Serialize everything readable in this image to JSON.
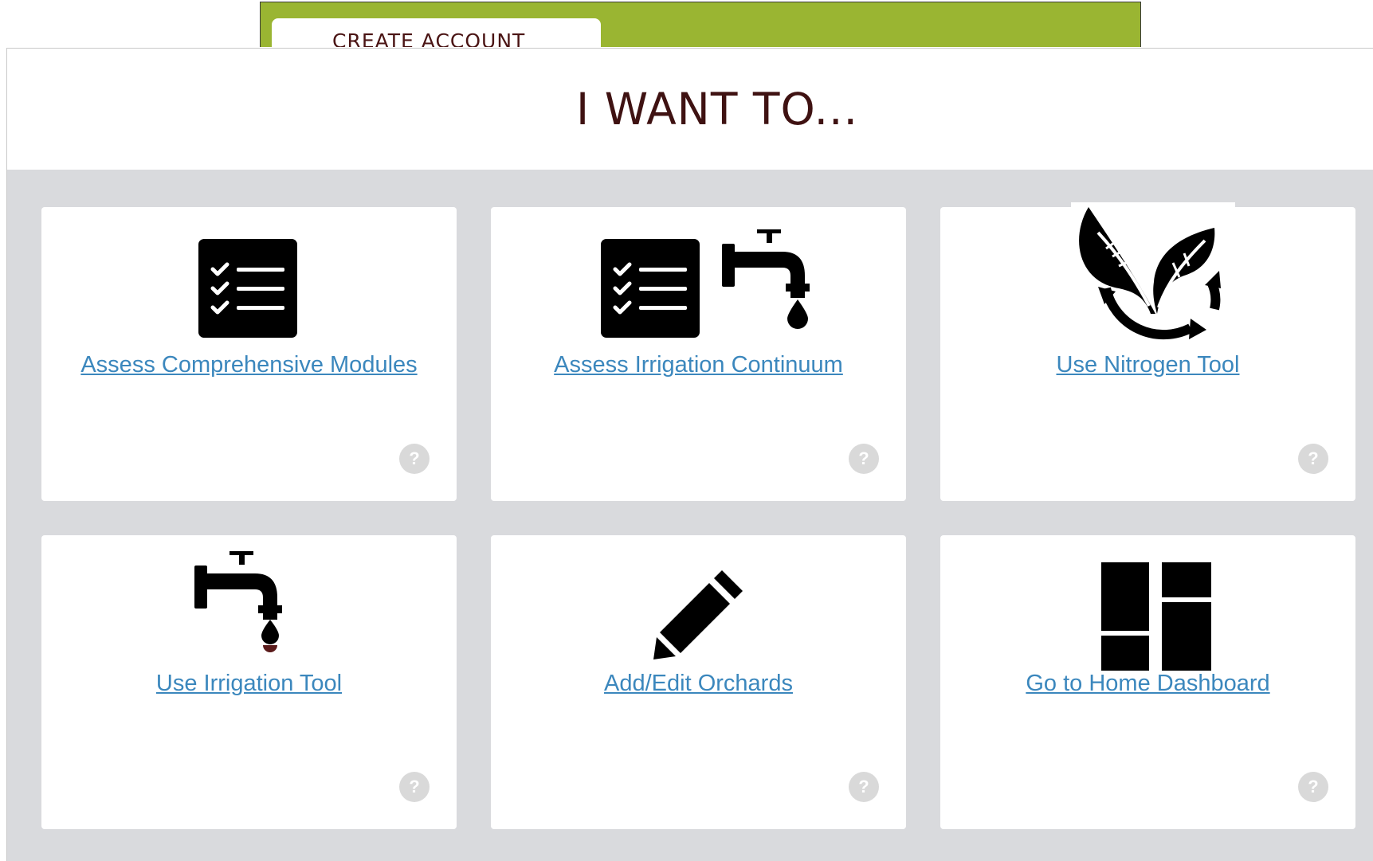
{
  "top_bar": {
    "tab_label": "CREATE ACCOUNT",
    "accent_color": "#9ab532"
  },
  "modal": {
    "title": "I WANT TO..."
  },
  "cards": [
    {
      "label": "Assess Comprehensive Modules",
      "icon": "checklist-icon",
      "help": "?"
    },
    {
      "label": "Assess Irrigation Continuum",
      "icon": "checklist-faucet-icon",
      "help": "?"
    },
    {
      "label": "Use Nitrogen Tool",
      "icon": "leaf-cycle-icon",
      "help": "?"
    },
    {
      "label": "Use Irrigation Tool",
      "icon": "faucet-icon",
      "help": "?"
    },
    {
      "label": "Add/Edit Orchards",
      "icon": "pencil-icon",
      "help": "?"
    },
    {
      "label": "Go to Home Dashboard",
      "icon": "dashboard-icon",
      "help": "?"
    }
  ],
  "colors": {
    "link": "#3b87bd",
    "title": "#3f1212",
    "body_bg": "#d9dadd"
  }
}
